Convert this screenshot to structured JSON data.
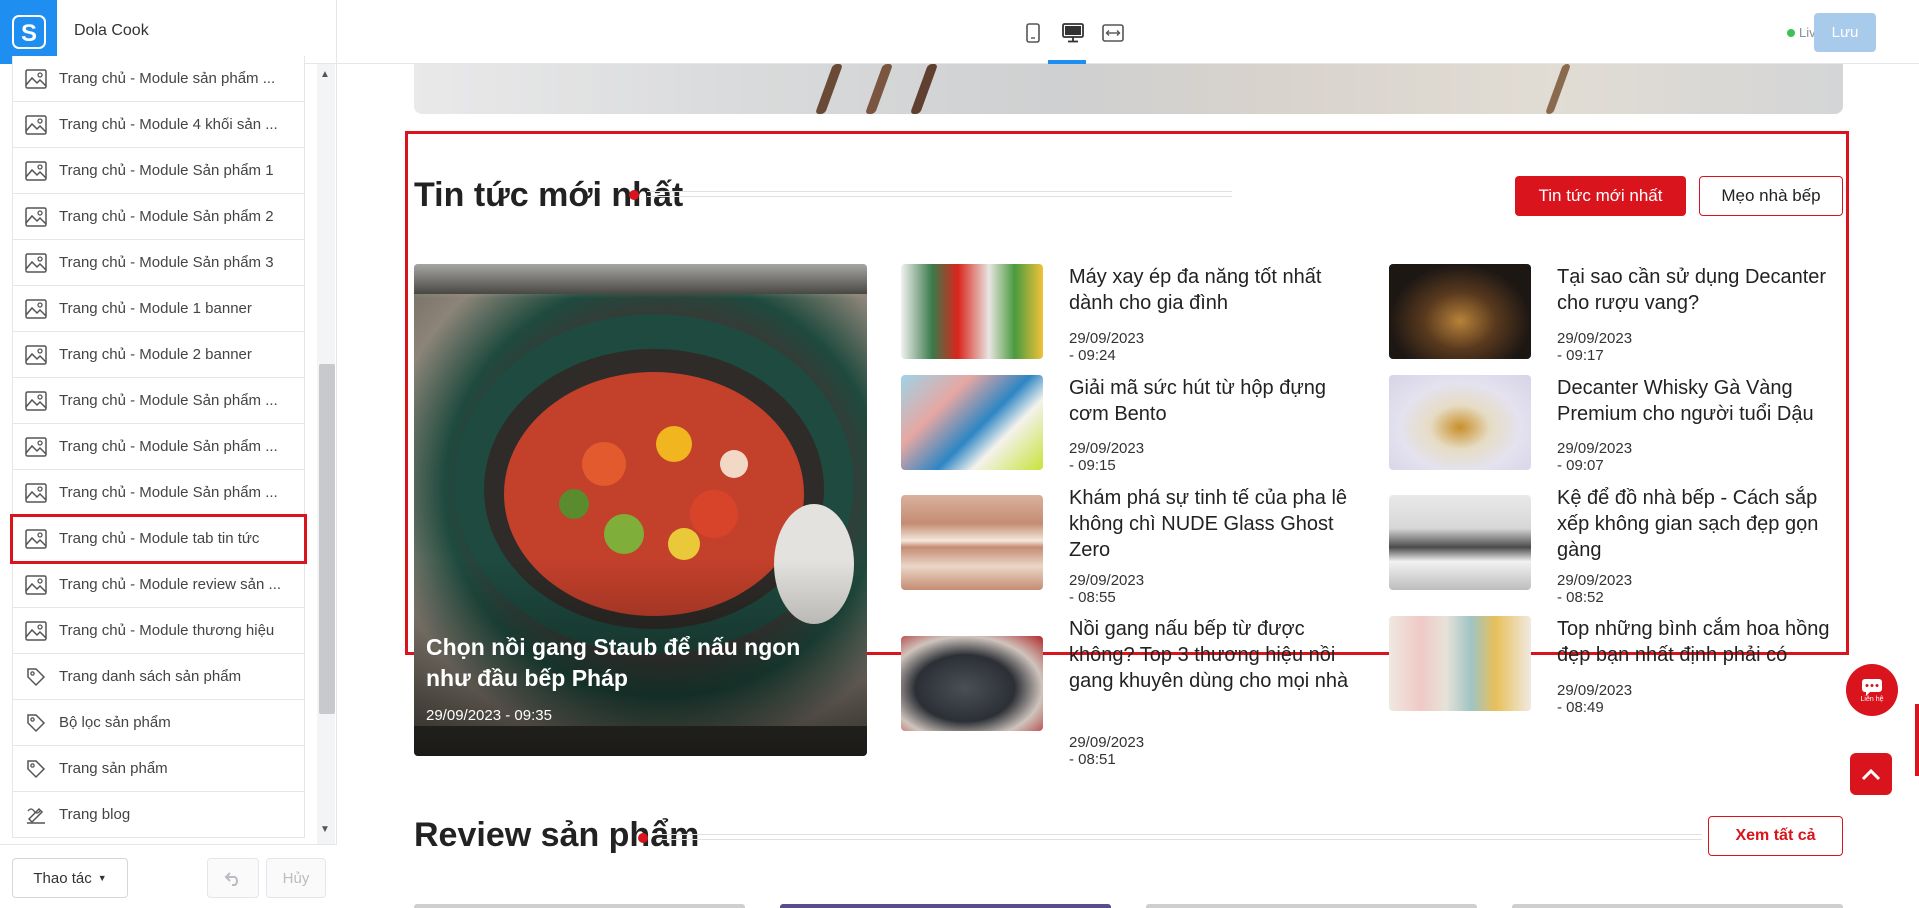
{
  "topbar": {
    "logo": "S",
    "store_name": "Dola Cook",
    "devices": [
      "mobile-icon",
      "desktop-icon",
      "fullwidth-icon"
    ],
    "live_label": "Live",
    "save_label": "Lưu",
    "colors": {
      "accent": "#1f8ef1",
      "live": "#3ec257",
      "save_bg": "#a8cbec"
    }
  },
  "sidebar": {
    "items": [
      {
        "label": "Trang chủ - Module sản phẩm ...",
        "icon": "image-layout-icon"
      },
      {
        "label": "Trang chủ - Module 4 khối sản ...",
        "icon": "image-layout-icon"
      },
      {
        "label": "Trang chủ - Module Sản phẩm 1",
        "icon": "image-layout-icon"
      },
      {
        "label": "Trang chủ - Module Sản phẩm 2",
        "icon": "image-layout-icon"
      },
      {
        "label": "Trang chủ - Module Sản phẩm 3",
        "icon": "image-layout-icon"
      },
      {
        "label": "Trang chủ - Module 1 banner",
        "icon": "image-layout-icon"
      },
      {
        "label": "Trang chủ - Module 2 banner",
        "icon": "image-layout-icon"
      },
      {
        "label": "Trang chủ - Module Sản phẩm ...",
        "icon": "image-layout-icon"
      },
      {
        "label": "Trang chủ - Module Sản phẩm ...",
        "icon": "image-layout-icon"
      },
      {
        "label": "Trang chủ - Module Sản phẩm ...",
        "icon": "image-layout-icon"
      },
      {
        "label": "Trang chủ - Module tab tin tức",
        "icon": "image-layout-icon",
        "selected": true
      },
      {
        "label": "Trang chủ - Module review sản ...",
        "icon": "image-layout-icon"
      },
      {
        "label": "Trang chủ - Module thương hiệu",
        "icon": "image-layout-icon"
      },
      {
        "label": "Trang danh sách sản phẩm",
        "icon": "tag-icon"
      },
      {
        "label": "Bộ lọc sản phẩm",
        "icon": "tag-icon"
      },
      {
        "label": "Trang sản phẩm",
        "icon": "tag-icon"
      },
      {
        "label": "Trang blog",
        "icon": "blog-icon"
      }
    ],
    "actions_label": "Thao tác",
    "cancel_label": "Hủy"
  },
  "preview": {
    "news": {
      "title": "Tin tức mới nhất",
      "tabs": [
        "Tin tức mới nhất",
        "Mẹo nhà bếp"
      ],
      "featured": {
        "title": "Chọn nồi gang Staub để nấu ngon như đầu bếp Pháp",
        "date": "29/09/2023 - 09:35"
      },
      "articles_left": [
        {
          "title": "Máy xay ép đa năng tốt nhất dành cho gia đình",
          "date": "29/09/2023 - 09:24"
        },
        {
          "title": "Giải mã sức hút từ hộp đựng cơm Bento",
          "date": "29/09/2023 - 09:15"
        },
        {
          "title": "Khám phá sự tinh tế của pha lê không chì NUDE Glass Ghost Zero",
          "date": "29/09/2023 - 08:55"
        },
        {
          "title": "Nồi gang nấu bếp từ được không? Top 3 thương hiệu nồi gang khuyên dùng cho mọi nhà",
          "date": "29/09/2023 - 08:51"
        }
      ],
      "articles_right": [
        {
          "title": "Tại sao cần sử dụng Decanter cho rượu vang?",
          "date": "29/09/2023 - 09:17"
        },
        {
          "title": "Decanter Whisky Gà Vàng Premium cho người tuổi Dậu",
          "date": "29/09/2023 - 09:07"
        },
        {
          "title": "Kệ để đồ nhà bếp - Cách sắp xếp không gian sạch đẹp gọn gàng",
          "date": "29/09/2023 - 08:52"
        },
        {
          "title": "Top những bình cắm hoa hồng đẹp bạn nhất định phải có",
          "date": "29/09/2023 - 08:49"
        }
      ]
    },
    "review": {
      "title": "Review sản phẩm",
      "see_all": "Xem tất cả"
    },
    "contact_label": "Liên hệ",
    "colors": {
      "brand_red": "#d9141c"
    }
  }
}
